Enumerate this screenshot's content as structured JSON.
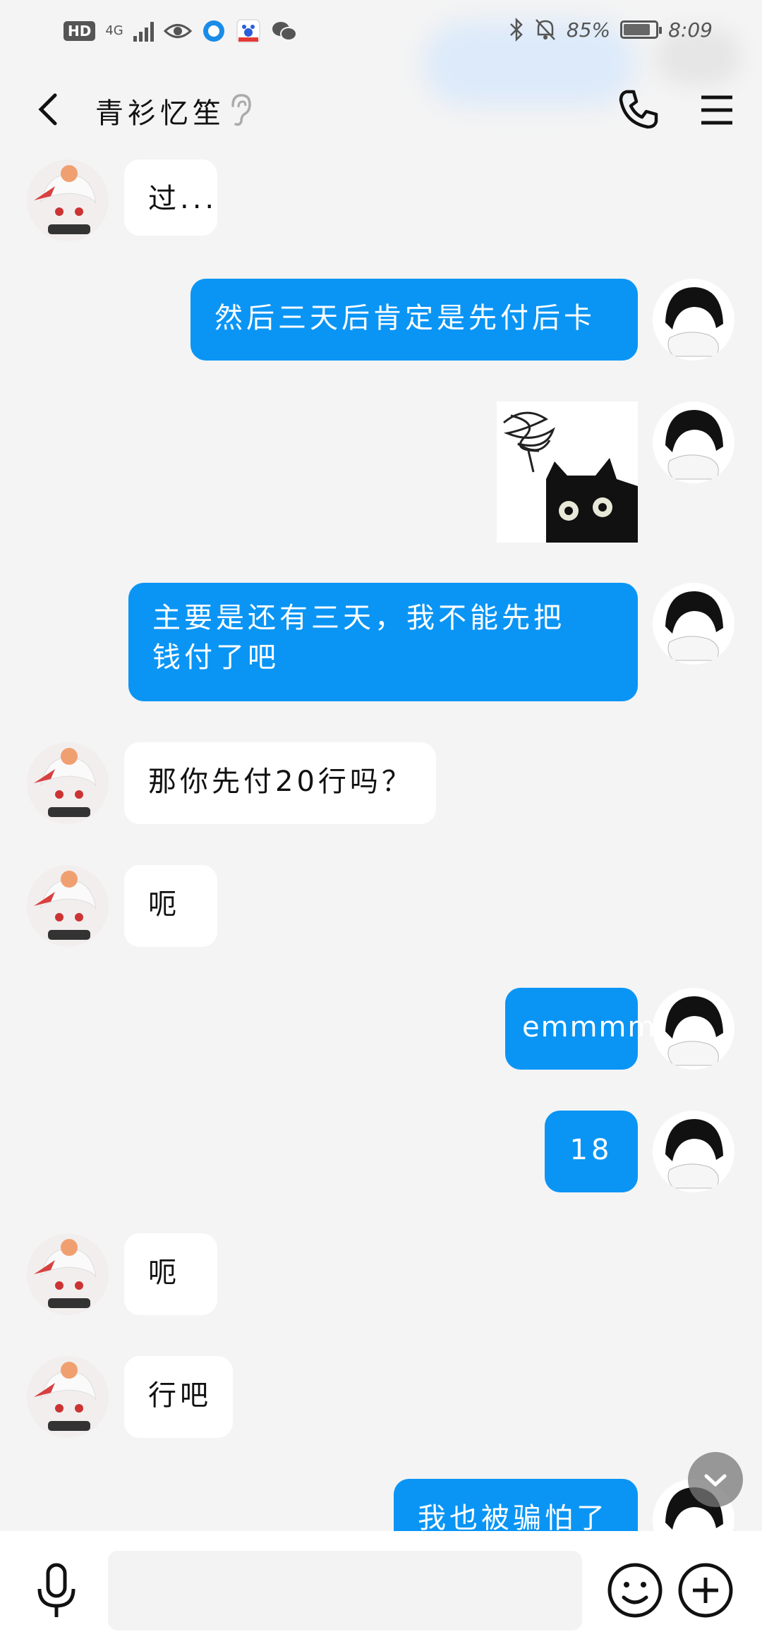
{
  "status_bar": {
    "hd": "HD",
    "network": "4G",
    "battery": "85%",
    "battery_level": 0.85,
    "time": "8:09"
  },
  "header": {
    "title": "青衫忆笙"
  },
  "messages": [
    {
      "side": "in",
      "type": "text",
      "text": "过..."
    },
    {
      "side": "out",
      "type": "text",
      "text": "然后三天后肯定是先付后卡"
    },
    {
      "side": "out",
      "type": "image",
      "description": "sticker-black-cat"
    },
    {
      "side": "out",
      "type": "text",
      "lines": [
        "主要是还有三天，我不能先把",
        "钱付了吧"
      ]
    },
    {
      "side": "in",
      "type": "text",
      "text": "那你先付20行吗？"
    },
    {
      "side": "in",
      "type": "text",
      "text": "呃"
    },
    {
      "side": "out",
      "type": "text",
      "text": "emmmm"
    },
    {
      "side": "out",
      "type": "text",
      "text": "18"
    },
    {
      "side": "in",
      "type": "text",
      "text": "呃"
    },
    {
      "side": "in",
      "type": "text",
      "text": "行吧"
    },
    {
      "side": "out",
      "type": "text",
      "text": "我也被骗怕了"
    }
  ],
  "icons": {
    "back": "chevron-left-icon",
    "ear": "ear-icon",
    "phone": "phone-icon",
    "menu": "menu-icon",
    "mic": "microphone-icon",
    "emoji": "emoji-icon",
    "plus": "plus-icon",
    "scroll": "chevron-down-icon"
  },
  "colors": {
    "outgoing_bubble": "#0a95f5",
    "incoming_bubble": "#ffffff",
    "background": "#f4f4f4"
  }
}
